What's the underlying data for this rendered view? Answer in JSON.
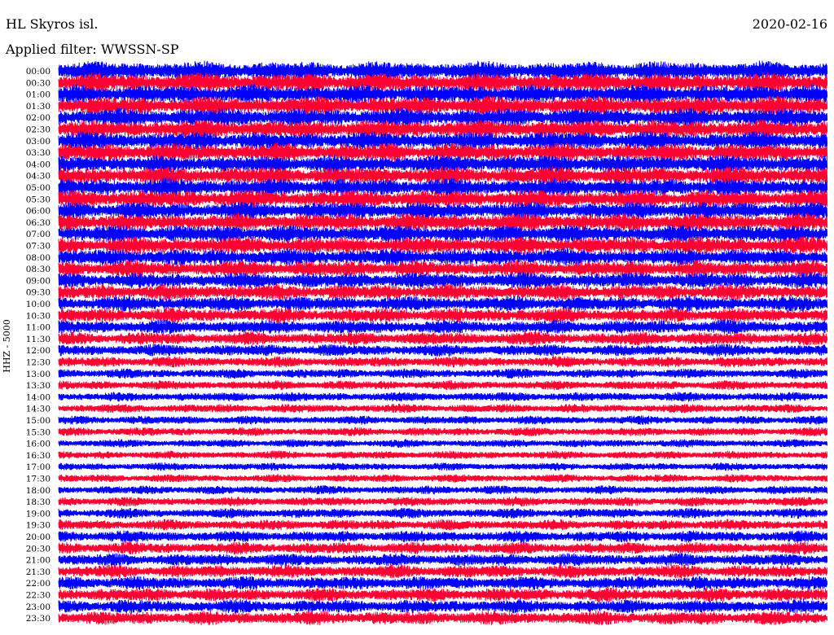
{
  "header": {
    "station": "HL Skyros isl.",
    "date": "2020-02-16",
    "filter": "Applied filter: WWSSN-SP"
  },
  "colors": {
    "trace_a": "#0000ff",
    "trace_b": "#ff0033",
    "background": "#ffffff"
  },
  "chart_data": {
    "type": "line",
    "title": "HL Skyros isl.",
    "subtitle": "Applied filter: WWSSN-SP",
    "date": "2020-02-16",
    "ylabel": "HHZ - 5000",
    "xlabel": "",
    "grid": false,
    "legend": "none",
    "row_interval_minutes": 30,
    "tick_labels": [
      "00:00",
      "00:30",
      "01:00",
      "01:30",
      "02:00",
      "02:30",
      "03:00",
      "03:30",
      "04:00",
      "04:30",
      "05:00",
      "05:30",
      "06:00",
      "06:30",
      "07:00",
      "07:30",
      "08:00",
      "08:30",
      "09:00",
      "09:30",
      "10:00",
      "10:30",
      "11:00",
      "11:30",
      "12:00",
      "12:30",
      "13:00",
      "13:30",
      "14:00",
      "14:30",
      "15:00",
      "15:30",
      "16:00",
      "16:30",
      "17:00",
      "17:30",
      "18:00",
      "18:30",
      "19:00",
      "19:30",
      "20:00",
      "20:30",
      "21:00",
      "21:30",
      "22:00",
      "22:30",
      "23:00",
      "23:30"
    ],
    "series": [
      {
        "color": "#0000ff",
        "rows": "even"
      },
      {
        "color": "#ff0033",
        "rows": "odd"
      }
    ],
    "relative_amplitude": [
      1.0,
      0.98,
      0.97,
      0.96,
      0.95,
      0.94,
      0.94,
      0.93,
      0.92,
      0.92,
      0.92,
      0.92,
      0.9,
      0.9,
      0.9,
      0.88,
      0.86,
      0.84,
      0.82,
      0.8,
      0.78,
      0.75,
      0.72,
      0.68,
      0.62,
      0.56,
      0.5,
      0.48,
      0.48,
      0.46,
      0.45,
      0.45,
      0.42,
      0.42,
      0.4,
      0.42,
      0.45,
      0.48,
      0.52,
      0.55,
      0.6,
      0.62,
      0.65,
      0.68,
      0.7,
      0.7,
      0.7,
      0.72
    ]
  }
}
